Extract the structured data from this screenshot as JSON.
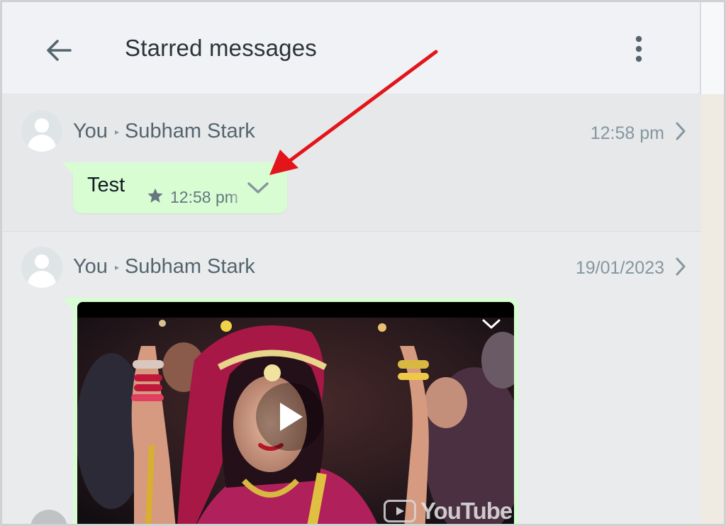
{
  "header": {
    "title": "Starred messages"
  },
  "messages": [
    {
      "sender": "You",
      "recipient": "Subham Stark",
      "time": "12:58 pm",
      "text": "Test",
      "bubble_time": "12:58 pm",
      "starred": true
    },
    {
      "sender": "You",
      "recipient": "Subham Stark",
      "time": "19/01/2023",
      "media": "video",
      "watermark": "YouTube"
    }
  ],
  "colors": {
    "bubble": "#d9fdd3",
    "header_bg": "#f0f2f5",
    "annotation_arrow": "#e3151a"
  },
  "icons": [
    "back-arrow-icon",
    "more-vertical-icon",
    "avatar-icon",
    "chevron-right-icon",
    "star-icon",
    "chevron-down-icon",
    "play-icon",
    "youtube-icon"
  ]
}
